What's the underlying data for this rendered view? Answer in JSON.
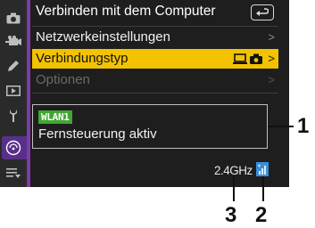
{
  "menu": {
    "title": "Verbinden mit dem Computer",
    "items": [
      {
        "label": "Netzwerkeinstellungen",
        "chevron": ">",
        "state": "normal"
      },
      {
        "label": "Verbindungstyp",
        "chevron": ">",
        "state": "selected"
      },
      {
        "label": "Optionen",
        "chevron": ">",
        "state": "disabled"
      }
    ]
  },
  "status": {
    "badge": "WLAN1",
    "text": "Fernsteuerung aktiv"
  },
  "footer": {
    "band": "2.4GHz",
    "signal_icon": "wifi-signal-icon"
  },
  "callouts": [
    "1",
    "3",
    "2"
  ],
  "colors": {
    "selected_row": "#f3c200",
    "badge": "#3fa830",
    "sidebar_active": "#58308a",
    "signal_icon": "#3a8fd8"
  },
  "sidebar_icons": [
    "camera-icon",
    "movie-camera-icon",
    "pencil-icon",
    "playback-icon",
    "wrench-icon",
    "network-icon",
    "my-menu-icon"
  ]
}
